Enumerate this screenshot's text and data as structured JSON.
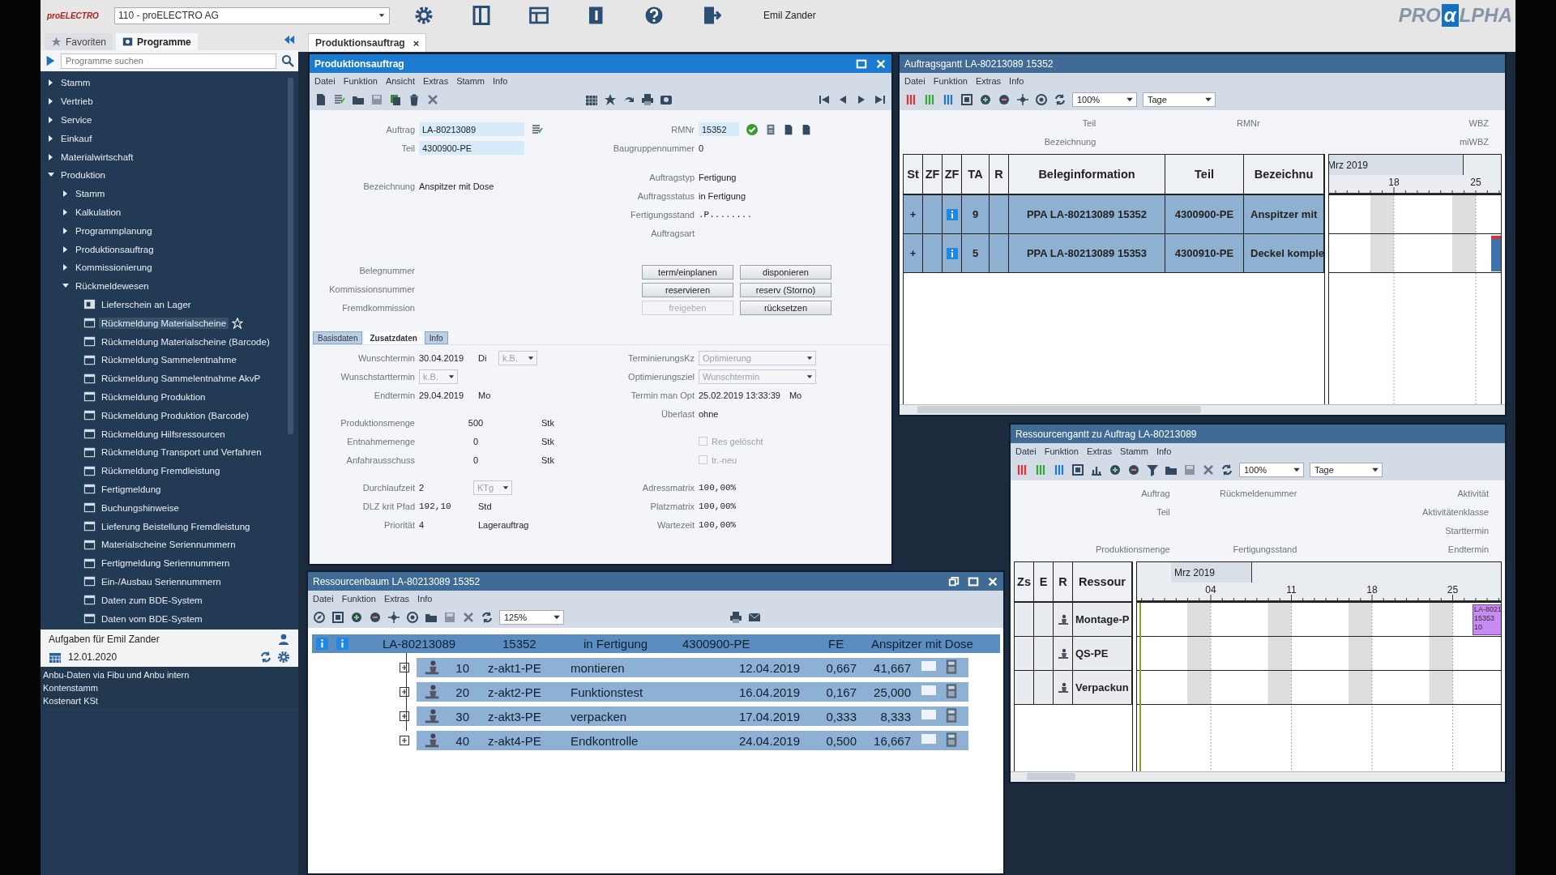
{
  "header": {
    "company_logo": "proELECTRO",
    "company": "110 - proELECTRO AG",
    "user": "Emil Zander",
    "brand": {
      "left": "PRO",
      "mark": "α",
      "right": "LPHA"
    }
  },
  "sidebar": {
    "tabs": [
      {
        "label": "Favoriten",
        "selected": false
      },
      {
        "label": "Programme",
        "selected": true
      }
    ],
    "search": {
      "placeholder": "Programme suchen"
    },
    "tree": [
      {
        "label": "Stamm",
        "expanded": false
      },
      {
        "label": "Vertrieb",
        "expanded": false
      },
      {
        "label": "Service",
        "expanded": false
      },
      {
        "label": "Einkauf",
        "expanded": false
      },
      {
        "label": "Materialwirtschaft",
        "expanded": false
      },
      {
        "label": "Produktion",
        "expanded": true,
        "children": [
          {
            "label": "Stamm",
            "expanded": false
          },
          {
            "label": "Kalkulation",
            "expanded": false
          },
          {
            "label": "Programmplanung",
            "expanded": false
          },
          {
            "label": "Produktionsauftrag",
            "expanded": false
          },
          {
            "label": "Kommissionierung",
            "expanded": false
          },
          {
            "label": "Rückmeldewesen",
            "expanded": true,
            "children": [
              {
                "label": "Lieferschein an Lager",
                "kind": "report",
                "hovered": false
              },
              {
                "label": "Rückmeldung Materialscheine",
                "kind": "program",
                "hovered": true
              },
              {
                "label": "Rückmeldung Materialscheine (Barcode)",
                "kind": "program",
                "hovered": false
              },
              {
                "label": "Rückmeldung Sammelentnahme",
                "kind": "program",
                "hovered": false
              },
              {
                "label": "Rückmeldung Sammelentnahme AkvP",
                "kind": "program",
                "hovered": false
              },
              {
                "label": "Rückmeldung Produktion",
                "kind": "program",
                "hovered": false
              },
              {
                "label": "Rückmeldung Produktion (Barcode)",
                "kind": "program",
                "hovered": false
              },
              {
                "label": "Rückmeldung Hilfsressourcen",
                "kind": "program",
                "hovered": false
              },
              {
                "label": "Rückmeldung Transport und Verfahren",
                "kind": "program",
                "hovered": false
              },
              {
                "label": "Rückmeldung Fremdleistung",
                "kind": "program",
                "hovered": false
              },
              {
                "label": "Fertigmeldung",
                "kind": "program",
                "hovered": false
              },
              {
                "label": "Buchungshinweise",
                "kind": "program",
                "hovered": false
              },
              {
                "label": "Lieferung Beistellung Fremdleistung",
                "kind": "program",
                "hovered": false
              },
              {
                "label": "Materialscheine Seriennummern",
                "kind": "program",
                "hovered": false
              },
              {
                "label": "Fertigmeldung Seriennummern",
                "kind": "program",
                "hovered": false
              },
              {
                "label": "Ein-/Ausbau Seriennummern",
                "kind": "program",
                "hovered": false
              },
              {
                "label": "Daten zum BDE-System",
                "kind": "program",
                "hovered": false
              },
              {
                "label": "Daten vom BDE-System",
                "kind": "program",
                "hovered": false
              }
            ]
          }
        ]
      }
    ],
    "tasks": {
      "title": "Aufgaben für Emil Zander",
      "date": "12.01.2020",
      "items": [
        "Anbu-Daten via Fibu und Anbu intern",
        "Kontenstamm",
        "Kostenart KSt"
      ]
    }
  },
  "workspace_tabs": [
    {
      "label": "Produktionsauftrag",
      "selected": true,
      "close": "×"
    }
  ],
  "production_order": {
    "title": "Produktionsauftrag",
    "menu": [
      "Datei",
      "Funktion",
      "Ansicht",
      "Extras",
      "Stamm",
      "Info"
    ],
    "left_groups": [
      [
        {
          "kind": "input",
          "label": "Auftrag",
          "value": "LA-80213089"
        },
        {
          "kind": "input",
          "label": "Teil",
          "value": "4300900-PE"
        }
      ],
      [
        {
          "kind": "text",
          "label": "Bezeichnung",
          "value": "Anspitzer mit Dose"
        }
      ],
      [
        {
          "kind": "text",
          "label": "Belegnummer"
        },
        {
          "kind": "text",
          "label": "Kommissionsnummer"
        },
        {
          "kind": "text",
          "label": "Fremdkommission"
        }
      ]
    ],
    "right_groups": [
      [
        {
          "kind": "input",
          "label": "RMNr",
          "value": "15352"
        },
        {
          "kind": "text",
          "label": "Baugruppennummer",
          "value": "0"
        }
      ],
      [
        {
          "kind": "text",
          "label": "Auftragstyp",
          "value": "Fertigung"
        },
        {
          "kind": "text",
          "label": "Auftragsstatus",
          "value": "in Fertigung"
        },
        {
          "kind": "mono",
          "label": "Fertigungsstand",
          "value": ".P........"
        },
        {
          "kind": "text",
          "label": "Auftragsart"
        }
      ]
    ],
    "actions": [
      {
        "label": "term/einplanen",
        "disabled": false
      },
      {
        "label": "disponieren",
        "disabled": false
      },
      {
        "label": "reservieren",
        "disabled": false
      },
      {
        "label": "reserv (Storno)",
        "disabled": false
      },
      {
        "label": "freigeben",
        "disabled": true
      },
      {
        "label": "rücksetzen",
        "disabled": false
      }
    ],
    "tabs": [
      {
        "label": "Basisdaten",
        "selected": false
      },
      {
        "label": "Zusatzdaten",
        "selected": true
      },
      {
        "label": "Info",
        "selected": false
      }
    ],
    "detail_left": [
      [
        {
          "kind": "text",
          "label": "Wunschtermin",
          "value": "30.04.2019",
          "suffix": "Di",
          "combo": {
            "value": "k.B.",
            "disabled": true
          }
        },
        {
          "kind": "text",
          "label": "Wunschstarttermin",
          "combo": {
            "value": "k.B.",
            "disabled": true
          }
        },
        {
          "kind": "text",
          "label": "Endtermin",
          "value": "29.04.2019",
          "suffix": "Mo"
        }
      ],
      [
        {
          "kind": "number",
          "label": "Produktionsmenge",
          "value": "500",
          "suffix": "Stk"
        },
        {
          "kind": "number",
          "label": "Entnahmemenge",
          "value": "0",
          "suffix": "Stk"
        },
        {
          "kind": "number",
          "label": "Anfahrausschuss",
          "value": "0",
          "suffix": "Stk"
        }
      ],
      [
        {
          "kind": "text",
          "label": "Durchlaufzeit",
          "value": "2",
          "combo": {
            "value": "KTg",
            "disabled": true
          }
        },
        {
          "kind": "mono",
          "label": "DLZ krit Pfad",
          "value": "192,10",
          "suffix": "Std"
        },
        {
          "kind": "text",
          "label": "Priorität",
          "value": "4",
          "suffix": "Lagerauftrag"
        }
      ]
    ],
    "detail_right": [
      [
        {
          "kind": "text",
          "label": "TerminierungsKz",
          "combo": {
            "value": "Optimierung",
            "disabled": true
          }
        },
        {
          "kind": "text",
          "label": "Optimierungsziel",
          "combo": {
            "value": "Wunschtermin",
            "disabled": true
          }
        },
        {
          "kind": "text",
          "label": "Termin man Opt",
          "value": "25.02.2019 13:33:39",
          "suffix": "Mo"
        },
        {
          "kind": "text",
          "label": "Überlast",
          "value": "ohne"
        }
      ],
      [
        {
          "kind": "checkbox",
          "label": "Res gelöscht",
          "checked": false,
          "disabled": true
        },
        {
          "kind": "checkbox",
          "label": "tr.-neu",
          "checked": false,
          "disabled": true
        }
      ],
      [
        {
          "kind": "mono",
          "label": "Adressmatrix",
          "value": "100,00%"
        },
        {
          "kind": "mono",
          "label": "Platzmatrix",
          "value": "100,00%"
        },
        {
          "kind": "mono",
          "label": "Wartezeit",
          "value": "100,00%"
        }
      ]
    ]
  },
  "order_gantt": {
    "title": "Auftragsgantt LA-80213089 15352",
    "menu": [
      "Datei",
      "Funktion",
      "Extras",
      "Info"
    ],
    "zoom": "100%",
    "scale": "Tage",
    "info_rows": [
      {
        "left": "Teil",
        "middle": "RMNr",
        "right": "WBZ"
      },
      {
        "left": "Bezeichnung",
        "right": "miWBZ"
      }
    ],
    "columns": [
      "St",
      "ZF",
      "ZF",
      "TA",
      "R",
      "Beleginformation",
      "Teil",
      "Bezeichnu"
    ],
    "rows": [
      {
        "status": "+",
        "ta": "9",
        "document": "PPA LA-80213089 15352",
        "part": "4300900-PE",
        "name": "Anspitzer mit",
        "selected": true,
        "bar": false
      },
      {
        "status": "+",
        "ta": "5",
        "document": "PPA LA-80213089 15353",
        "part": "4300910-PE",
        "name": "Deckel komple",
        "selected": true,
        "bar": true
      }
    ],
    "timeline": {
      "month": "Mrz 2019",
      "days": [
        "18",
        "25"
      ]
    }
  },
  "resource_gantt": {
    "title": "Ressourcengantt zu Auftrag LA-80213089",
    "menu": [
      "Datei",
      "Funktion",
      "Extras",
      "Stamm",
      "Info"
    ],
    "zoom": "100%",
    "scale": "Tage",
    "info_rows": [
      {
        "left": "Auftrag",
        "middle": "Rückmeldenummer",
        "right": "Aktivität"
      },
      {
        "left": "Teil",
        "right": "Aktivitätenklasse"
      },
      {
        "right": "Starttermin"
      },
      {
        "left": "Produktionsmenge",
        "middle": "Fertigungsstand",
        "right": "Endtermin"
      }
    ],
    "columns": [
      "Zs",
      "E",
      "R",
      "Ressour"
    ],
    "rows": [
      {
        "name": "Montage-P",
        "bar": [
          "LA-8021",
          "15353",
          "10"
        ]
      },
      {
        "name": "QS-PE"
      },
      {
        "name": "Verpackun"
      }
    ],
    "timeline": {
      "month": "Mrz 2019",
      "days": [
        "04",
        "11",
        "18",
        "25"
      ]
    }
  },
  "resource_tree": {
    "title": "Ressourcenbaum LA-80213089 15352",
    "menu": [
      "Datei",
      "Funktion",
      "Extras",
      "Info"
    ],
    "zoom": "125%",
    "root": {
      "selected": true,
      "cells": [
        "LA-80213089",
        "15352",
        "in Fertigung",
        "4300900-PE",
        "FE",
        "Anspitzer mit Dose"
      ]
    },
    "operations": [
      {
        "cells": [
          "10",
          "z-akt1-PE",
          "montieren",
          "12.04.2019",
          "0,667",
          "41,667"
        ],
        "expanded": false,
        "selected": false
      },
      {
        "cells": [
          "20",
          "z-akt2-PE",
          "Funktionstest",
          "16.04.2019",
          "0,167",
          "25,000"
        ],
        "expanded": false,
        "selected": false
      },
      {
        "cells": [
          "30",
          "z-akt3-PE",
          "verpacken",
          "17.04.2019",
          "0,333",
          "8,333"
        ],
        "expanded": false,
        "selected": false
      },
      {
        "cells": [
          "40",
          "z-akt4-PE",
          "Endkontrolle",
          "24.04.2019",
          "0,500",
          "16,667"
        ],
        "expanded": false,
        "selected": false
      }
    ]
  }
}
